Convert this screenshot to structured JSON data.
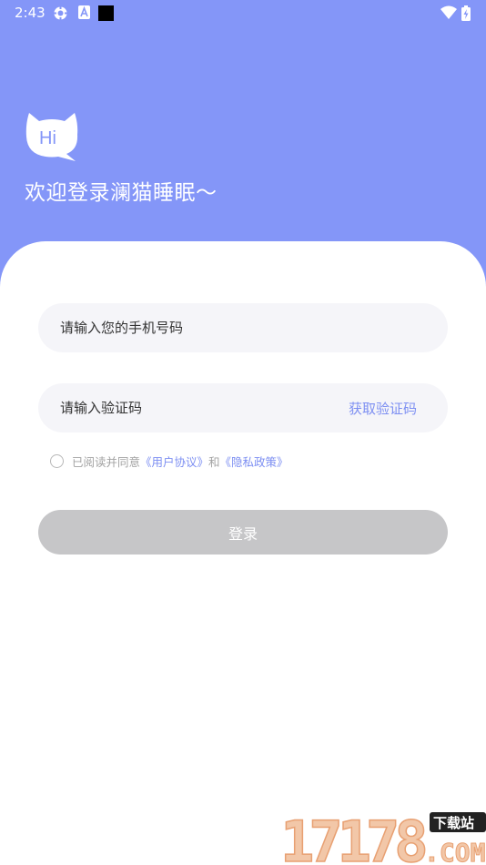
{
  "status_bar": {
    "time": "2:43",
    "icons": [
      "settings-gear-icon",
      "font-a-icon",
      "black-square-icon"
    ],
    "right_icons": [
      "wifi-icon",
      "battery-charging-icon"
    ]
  },
  "header": {
    "logo_text": "Hi",
    "welcome": "欢迎登录澜猫睡眠～"
  },
  "form": {
    "phone_placeholder": "请输入您的手机号码",
    "code_placeholder": "请输入验证码",
    "get_code": "获取验证码",
    "agree_prefix": "已阅读并同意",
    "user_agreement": "《用户协议》",
    "and": "和",
    "privacy_policy": "《隐私政策》",
    "login": "登录"
  },
  "colors": {
    "header_bg": "#8496f8",
    "accent": "#7d8ff2",
    "button_disabled": "#c6c6c8",
    "field_bg": "#f5f5f9"
  },
  "watermark": {
    "text": "17178",
    "badge": "下载站",
    "suffix": ".COM"
  }
}
